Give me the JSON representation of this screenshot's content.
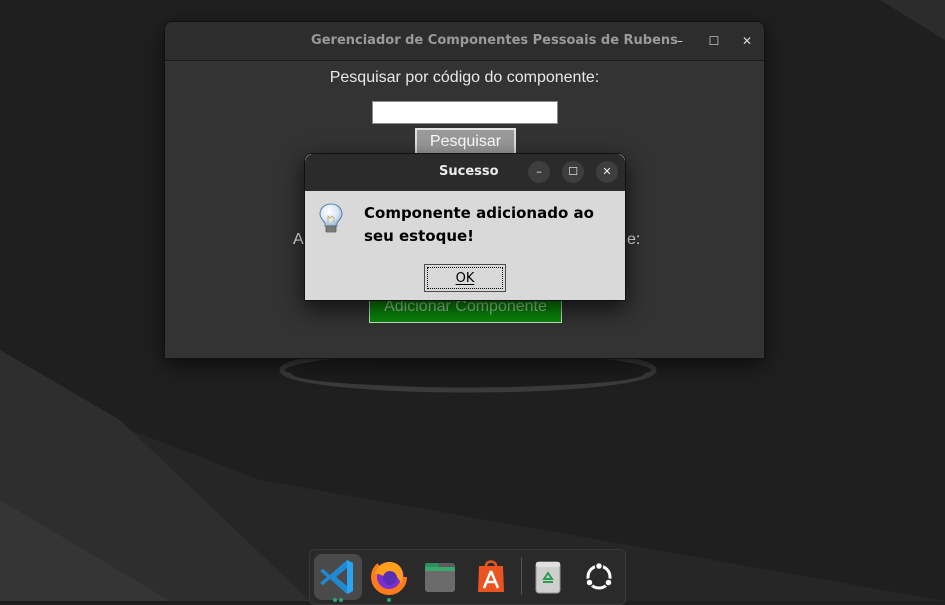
{
  "main_window": {
    "title": "Gerenciador de Componentes Pessoais de Rubens",
    "minimize_glyph": "–",
    "maximize_glyph": "☐",
    "close_glyph": "✕",
    "search_label": "Pesquisar por código do componente:",
    "search_value": "",
    "search_button": "Pesquisar",
    "add_label_left_visible": "A",
    "add_label_right_visible": "e:",
    "add_button": "Adicionar Componente"
  },
  "dialog": {
    "title": "Sucesso",
    "minimize_glyph": "–",
    "maximize_glyph": "☐",
    "close_glyph": "✕",
    "message": "Componente adicionado ao seu estoque!",
    "ok_button": "OK",
    "icon": "lightbulb-icon"
  },
  "dock": {
    "items": [
      {
        "name": "vscode-icon",
        "active": true,
        "running": true
      },
      {
        "name": "firefox-icon",
        "active": false,
        "running": true
      },
      {
        "name": "files-icon",
        "active": false,
        "running": false
      },
      {
        "name": "app-center-icon",
        "active": false,
        "running": false
      },
      {
        "name": "trash-icon",
        "active": false,
        "running": false
      },
      {
        "name": "show-apps-icon",
        "active": false,
        "running": false
      }
    ]
  },
  "colors": {
    "desktop": "#1f1f1f",
    "window_bg": "#333333",
    "dialog_bg": "#d9d9d9",
    "add_button": "#0a8c0a"
  }
}
